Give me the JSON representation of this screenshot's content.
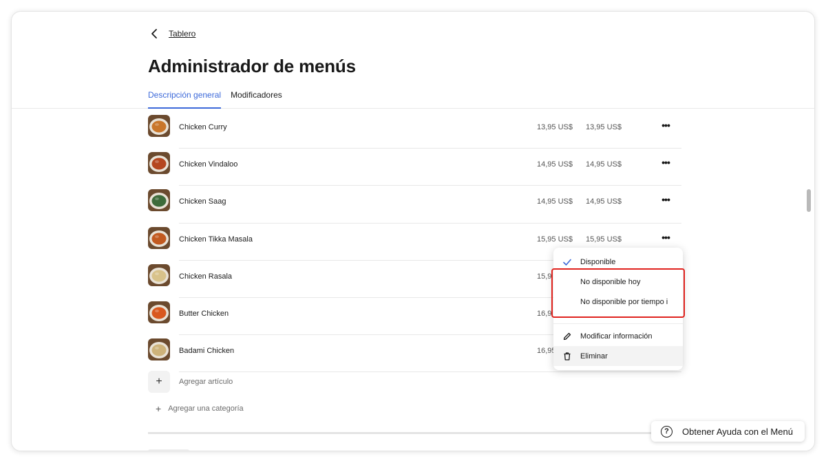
{
  "header": {
    "back_label": "Tablero",
    "title": "Administrador de menús",
    "tabs": [
      {
        "label": "Descripción general",
        "active": true
      },
      {
        "label": "Modificadores",
        "active": false
      }
    ]
  },
  "items": [
    {
      "name": "Chicken Curry",
      "price": "13,95 US$",
      "price2": "13,95 US$",
      "thumb_color": "#c9762a"
    },
    {
      "name": "Chicken Vindaloo",
      "price": "14,95 US$",
      "price2": "14,95 US$",
      "thumb_color": "#b5461f"
    },
    {
      "name": "Chicken Saag",
      "price": "14,95 US$",
      "price2": "14,95 US$",
      "thumb_color": "#3d6b3a"
    },
    {
      "name": "Chicken Tikka Masala",
      "price": "15,95 US$",
      "price2": "15,95 US$",
      "thumb_color": "#c25a20"
    },
    {
      "name": "Chicken Rasala",
      "price": "15,9",
      "price2": "",
      "thumb_color": "#d8c28a"
    },
    {
      "name": "Butter Chicken",
      "price": "16,9",
      "price2": "",
      "thumb_color": "#d9581f"
    },
    {
      "name": "Badami Chicken",
      "price": "16,95",
      "price2": "",
      "thumb_color": "#cdb27a"
    }
  ],
  "add_item_label": "Agregar artículo",
  "add_category_label": "Agregar una categoría",
  "context_menu": {
    "items": [
      {
        "label": "Disponible",
        "icon": "check-icon"
      },
      {
        "label": "No disponible hoy",
        "icon": ""
      },
      {
        "label": "No disponible por tiempo i",
        "icon": ""
      },
      {
        "label": "Modificar información",
        "icon": "pencil-icon"
      },
      {
        "label": "Eliminar",
        "icon": "trash-icon"
      }
    ]
  },
  "help_button_label": "Obtener Ayuda con el Menú",
  "colors": {
    "accent": "#3b68d9",
    "highlight": "#e0221d"
  }
}
